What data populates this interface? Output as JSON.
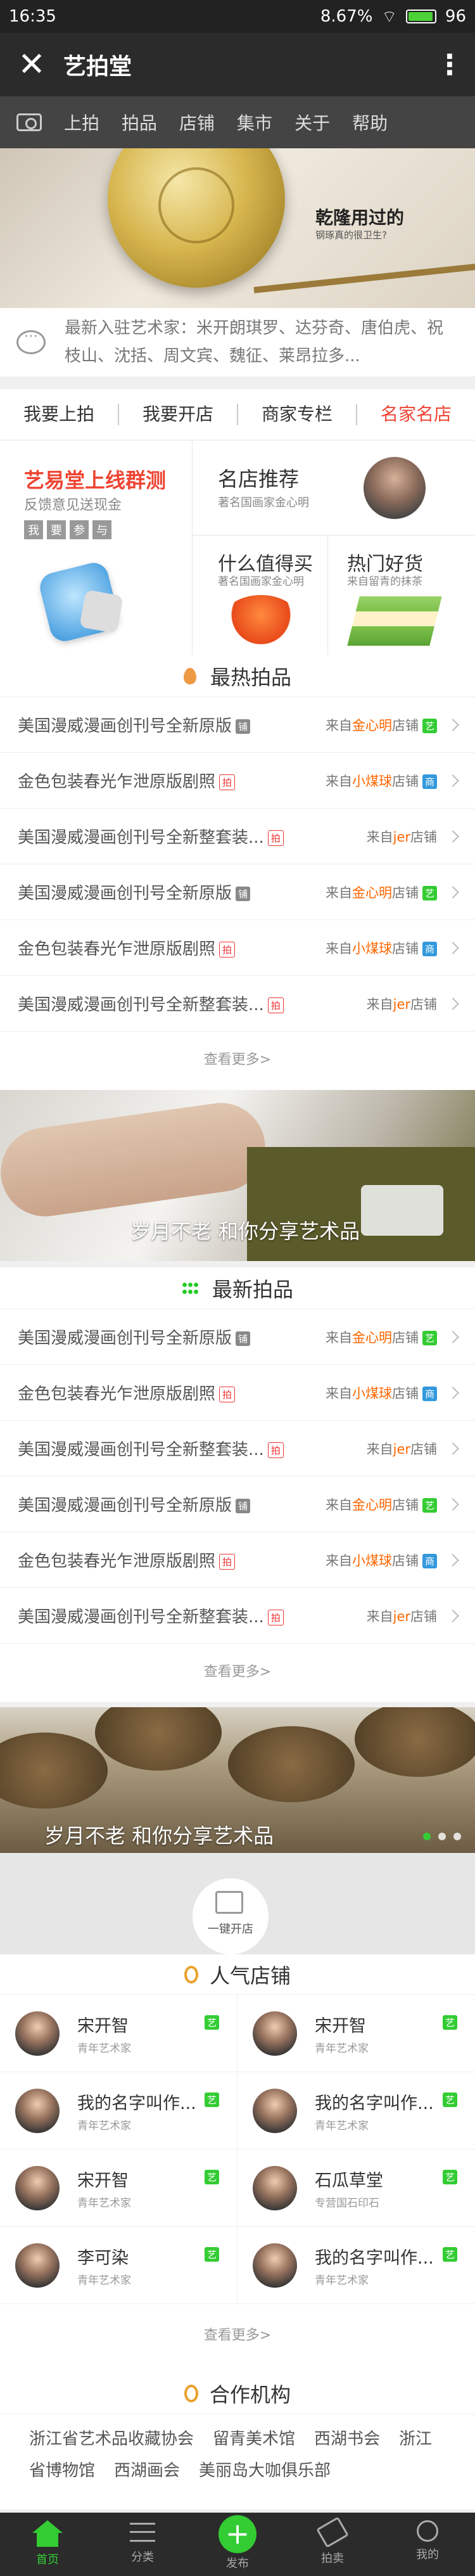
{
  "status_bar": {
    "time": "16:35",
    "battery_text": "8.67%",
    "battery_level": "96"
  },
  "title_bar": {
    "close_glyph": "✕",
    "title": "艺拍堂",
    "more_glyph": "⋮"
  },
  "nav": {
    "items": [
      "上拍",
      "拍品",
      "店铺",
      "集市",
      "关于",
      "帮助"
    ]
  },
  "banner_top": {
    "title": "乾隆用过的",
    "subtitle": "钢琢真的很卫生?"
  },
  "notice": {
    "text": "最新入驻艺术家：米开朗琪罗、达芬奇、唐伯虎、祝枝山、沈括、周文宾、魏征、莱昂拉多..."
  },
  "quick_tabs": [
    "我要上拍",
    "我要开店",
    "商家专栏",
    "名家名店"
  ],
  "promo": {
    "left": {
      "title": "艺易堂上线群测",
      "subtitle": "反馈意见送现金",
      "tags": [
        "我",
        "要",
        "参",
        "与"
      ]
    },
    "top_right": {
      "title": "名店推荐",
      "subtitle": "著名国画家金心明"
    },
    "bottom_left": {
      "title": "什么值得买",
      "subtitle": "著名国画家金心明"
    },
    "bottom_right": {
      "title": "热门好货",
      "subtitle": "来自留青的抹茶"
    }
  },
  "hot_lots": {
    "title": "最热拍品",
    "rows": [
      {
        "name": "美国漫威漫画创刊号全新原版",
        "badge": "铺",
        "badge_type": "gray",
        "src_prefix": "来自",
        "shop": "金心明",
        "src_suffix": "店铺",
        "shop_badge": "艺",
        "shop_badge_type": "green"
      },
      {
        "name": "金色包装春光乍泄原版剧照",
        "badge": "拍",
        "badge_type": "red",
        "src_prefix": "来自",
        "shop": "小煤球",
        "src_suffix": "店铺",
        "shop_badge": "商",
        "shop_badge_type": "blue"
      },
      {
        "name": "美国漫威漫画创刊号全新整套装...",
        "badge": "拍",
        "badge_type": "red",
        "src_prefix": "来自",
        "shop": "jer",
        "src_suffix": "店铺",
        "shop_badge": "",
        "shop_badge_type": ""
      },
      {
        "name": "美国漫威漫画创刊号全新原版",
        "badge": "铺",
        "badge_type": "gray",
        "src_prefix": "来自",
        "shop": "金心明",
        "src_suffix": "店铺",
        "shop_badge": "艺",
        "shop_badge_type": "green"
      },
      {
        "name": "金色包装春光乍泄原版剧照",
        "badge": "拍",
        "badge_type": "red",
        "src_prefix": "来自",
        "shop": "小煤球",
        "src_suffix": "店铺",
        "shop_badge": "商",
        "shop_badge_type": "blue"
      },
      {
        "name": "美国漫威漫画创刊号全新整套装...",
        "badge": "拍",
        "badge_type": "red",
        "src_prefix": "来自",
        "shop": "jer",
        "src_suffix": "店铺",
        "shop_badge": "",
        "shop_badge_type": ""
      }
    ],
    "more": "查看更多>"
  },
  "banner_mid": {
    "caption": "岁月不老 和你分享艺术品"
  },
  "new_lots": {
    "title": "最新拍品",
    "rows": [
      {
        "name": "美国漫威漫画创刊号全新原版",
        "badge": "铺",
        "badge_type": "gray",
        "src_prefix": "来自",
        "shop": "金心明",
        "src_suffix": "店铺",
        "shop_badge": "艺",
        "shop_badge_type": "green"
      },
      {
        "name": "金色包装春光乍泄原版剧照",
        "badge": "拍",
        "badge_type": "red",
        "src_prefix": "来自",
        "shop": "小煤球",
        "src_suffix": "店铺",
        "shop_badge": "商",
        "shop_badge_type": "blue"
      },
      {
        "name": "美国漫威漫画创刊号全新整套装...",
        "badge": "拍",
        "badge_type": "red",
        "src_prefix": "来自",
        "shop": "jer",
        "src_suffix": "店铺",
        "shop_badge": "",
        "shop_badge_type": ""
      },
      {
        "name": "美国漫威漫画创刊号全新原版",
        "badge": "铺",
        "badge_type": "gray",
        "src_prefix": "来自",
        "shop": "金心明",
        "src_suffix": "店铺",
        "shop_badge": "艺",
        "shop_badge_type": "green"
      },
      {
        "name": "金色包装春光乍泄原版剧照",
        "badge": "拍",
        "badge_type": "red",
        "src_prefix": "来自",
        "shop": "小煤球",
        "src_suffix": "店铺",
        "shop_badge": "商",
        "shop_badge_type": "blue"
      },
      {
        "name": "美国漫威漫画创刊号全新整套装...",
        "badge": "拍",
        "badge_type": "red",
        "src_prefix": "来自",
        "shop": "jer",
        "src_suffix": "店铺",
        "shop_badge": "",
        "shop_badge_type": ""
      }
    ],
    "more": "查看更多>"
  },
  "banner_bottom": {
    "caption": "岁月不老 和你分享艺术品"
  },
  "open_shop": {
    "label": "一键开店"
  },
  "popular_shops": {
    "title": "人气店铺",
    "shops": [
      {
        "name": "宋开智",
        "desc": "青年艺术家",
        "tag": "艺"
      },
      {
        "name": "宋开智",
        "desc": "青年艺术家",
        "tag": "艺"
      },
      {
        "name": "我的名字叫作...",
        "desc": "青年艺术家",
        "tag": "艺"
      },
      {
        "name": "我的名字叫作...",
        "desc": "青年艺术家",
        "tag": "艺"
      },
      {
        "name": "宋开智",
        "desc": "青年艺术家",
        "tag": "艺"
      },
      {
        "name": "石瓜草堂",
        "desc": "专营国石印石",
        "tag": "艺"
      },
      {
        "name": "李可染",
        "desc": "青年艺术家",
        "tag": "艺"
      },
      {
        "name": "我的名字叫作...",
        "desc": "青年艺术家",
        "tag": "艺"
      }
    ],
    "more": "查看更多>"
  },
  "partners": {
    "title": "合作机构",
    "items": [
      "浙江省艺术品收藏协会",
      "留青美术馆",
      "西湖书会",
      "浙江省博物馆",
      "西湖画会",
      "美丽岛大咖俱乐部"
    ]
  },
  "tab_bar": {
    "items": [
      "首页",
      "分类",
      "发布",
      "拍卖",
      "我的"
    ]
  },
  "colors": {
    "accent": "#33cc33",
    "highlight_red": "#ee4433",
    "shop_orange": "#ff6600"
  }
}
